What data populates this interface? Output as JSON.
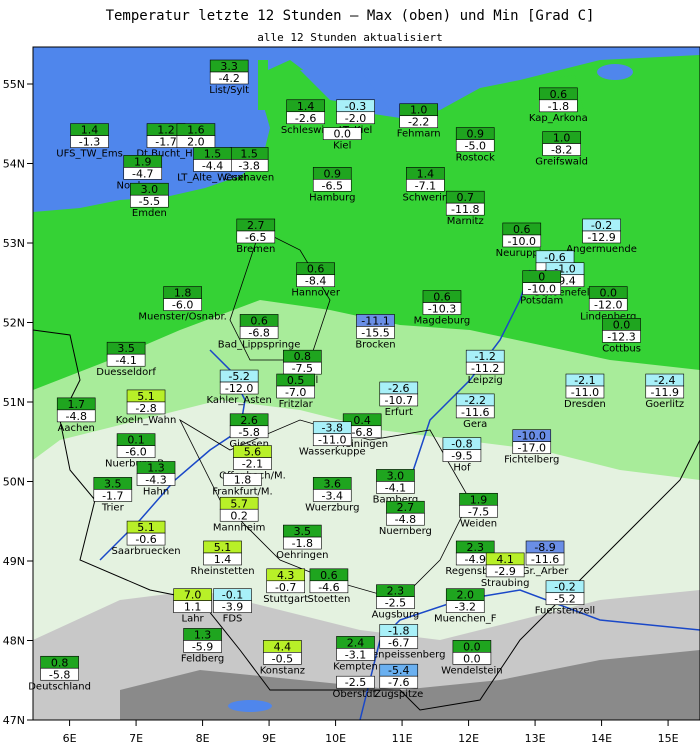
{
  "title": "Temperatur letzte 12 Stunden — Max (oben) und Min [Grad C]",
  "subtitle": "alle 12 Stunden aktualisiert",
  "lon_labels": [
    "6E",
    "7E",
    "8E",
    "9E",
    "10E",
    "11E",
    "12E",
    "13E",
    "14E",
    "15E"
  ],
  "lat_labels": [
    "55N",
    "54N",
    "53N",
    "52N",
    "51N",
    "50N",
    "49N",
    "48N",
    "47N"
  ],
  "stations": [
    {
      "name": "List/Sylt",
      "max": "3.3",
      "min": "-4.2",
      "lon": 8.4,
      "lat": 55.0,
      "c": "#1fa51f"
    },
    {
      "name": "UFS_TW_Ems",
      "max": "1.4",
      "min": "-1.3",
      "lon": 6.3,
      "lat": 54.2,
      "c": "#1fa51f"
    },
    {
      "name": "Dt.Bucht_H.",
      "max": "1.2",
      "min": "-1.7",
      "lon": 7.45,
      "lat": 54.2,
      "c": "#1fa51f"
    },
    {
      "name": "",
      "max": "1.6",
      "min": "2.0",
      "lon": 7.9,
      "lat": 54.2,
      "c": "#1fa51f"
    },
    {
      "name": "Cuxhaven",
      "max": "1.5",
      "min": "-3.8",
      "lon": 8.7,
      "lat": 53.9,
      "c": "#1fa51f"
    },
    {
      "name": "Norderney",
      "max": "1.9",
      "min": "-4.7",
      "lon": 7.1,
      "lat": 53.8,
      "c": "#1fa51f"
    },
    {
      "name": "LT_Alte_Weser",
      "max": "1.5",
      "min": "-4.4",
      "lon": 8.15,
      "lat": 53.9,
      "c": "#1fa51f"
    },
    {
      "name": "Emden",
      "max": "3.0",
      "min": "-5.5",
      "lon": 7.2,
      "lat": 53.45,
      "c": "#1fa51f"
    },
    {
      "name": "Schleswig",
      "max": "1.4",
      "min": "-2.6",
      "lon": 9.55,
      "lat": 54.5,
      "c": "#1fa51f"
    },
    {
      "name": "LT_Kiel",
      "max": "-0.3",
      "min": "-2.0",
      "lon": 10.3,
      "lat": 54.5,
      "c": "#a8f0f8"
    },
    {
      "name": "Kiel",
      "max": "",
      "min": "0.0",
      "lon": 10.1,
      "lat": 54.3,
      "c": "#1fa51f"
    },
    {
      "name": "Fehmarn",
      "max": "1.0",
      "min": "-2.2",
      "lon": 11.25,
      "lat": 54.45,
      "c": "#1fa51f"
    },
    {
      "name": "Rostock",
      "max": "0.9",
      "min": "-5.0",
      "lon": 12.1,
      "lat": 54.15,
      "c": "#1fa51f"
    },
    {
      "name": "Kap_Arkona",
      "max": "0.6",
      "min": "-1.8",
      "lon": 13.35,
      "lat": 54.65,
      "c": "#1fa51f"
    },
    {
      "name": "Greifswald",
      "max": "1.0",
      "min": "-8.2",
      "lon": 13.4,
      "lat": 54.1,
      "c": "#1fa51f"
    },
    {
      "name": "Hamburg",
      "max": "0.9",
      "min": "-6.5",
      "lon": 9.95,
      "lat": 53.65,
      "c": "#1fa51f"
    },
    {
      "name": "Schwerin",
      "max": "1.4",
      "min": "-7.1",
      "lon": 11.35,
      "lat": 53.65,
      "c": "#1fa51f"
    },
    {
      "name": "Marnitz",
      "max": "0.7",
      "min": "-11.8",
      "lon": 11.95,
      "lat": 53.35,
      "c": "#1fa51f"
    },
    {
      "name": "Bremen",
      "max": "2.7",
      "min": "-6.5",
      "lon": 8.8,
      "lat": 53.0,
      "c": "#1fa51f"
    },
    {
      "name": "Neuruppin",
      "max": "0.6",
      "min": "-10.0",
      "lon": 12.8,
      "lat": 52.95,
      "c": "#1fa51f"
    },
    {
      "name": "Angermuende",
      "max": "-0.2",
      "min": "-12.9",
      "lon": 14.0,
      "lat": 53.0,
      "c": "#a8f0f8"
    },
    {
      "name": "Tegel",
      "max": "-0.6",
      "min": "-9.4",
      "lon": 13.3,
      "lat": 52.6,
      "c": "#a8f0f8"
    },
    {
      "name": "Schoenefeld",
      "max": "-1.0",
      "min": "-9.4",
      "lon": 13.45,
      "lat": 52.45,
      "c": "#a8f0f8"
    },
    {
      "name": "Potsdam",
      "max": "0",
      "min": "-10.0",
      "lon": 13.1,
      "lat": 52.35,
      "c": "#1fa51f"
    },
    {
      "name": "Hannover",
      "max": "0.6",
      "min": "-8.4",
      "lon": 9.7,
      "lat": 52.45,
      "c": "#1fa51f"
    },
    {
      "name": "Muenster/Osnabr.",
      "max": "1.8",
      "min": "-6.0",
      "lon": 7.7,
      "lat": 52.15,
      "c": "#1fa51f"
    },
    {
      "name": "Lindenberg",
      "max": "0.0",
      "min": "-12.0",
      "lon": 14.1,
      "lat": 52.15,
      "c": "#1fa51f"
    },
    {
      "name": "Bad_Lippspringe",
      "max": "0.6",
      "min": "-6.8",
      "lon": 8.85,
      "lat": 51.8,
      "c": "#1fa51f"
    },
    {
      "name": "Magdeburg",
      "max": "0.6",
      "min": "-10.3",
      "lon": 11.6,
      "lat": 52.1,
      "c": "#1fa51f"
    },
    {
      "name": "Brocken",
      "max": "-11.1",
      "min": "-15.5",
      "lon": 10.6,
      "lat": 51.8,
      "c": "#6a8ee6"
    },
    {
      "name": "Cottbus",
      "max": "0.0",
      "min": "-12.3",
      "lon": 14.3,
      "lat": 51.75,
      "c": "#1fa51f"
    },
    {
      "name": "Duesseldorf",
      "max": "3.5",
      "min": "-4.1",
      "lon": 6.85,
      "lat": 51.45,
      "c": "#1fa51f"
    },
    {
      "name": "Kassel",
      "max": "0.8",
      "min": "-7.5",
      "lon": 9.5,
      "lat": 51.35,
      "c": "#1fa51f"
    },
    {
      "name": "Kahler_Asten",
      "max": "-5.2",
      "min": "-12.0",
      "lon": 8.55,
      "lat": 51.1,
      "c": "#a8f0f8"
    },
    {
      "name": "Fritzlar",
      "max": "0.5",
      "min": "-7.0",
      "lon": 9.4,
      "lat": 51.05,
      "c": "#1fa51f"
    },
    {
      "name": "Erfurt",
      "max": "-2.6",
      "min": "-10.7",
      "lon": 10.95,
      "lat": 50.95,
      "c": "#a8f0f8"
    },
    {
      "name": "Leipzig",
      "max": "-1.2",
      "min": "-11.2",
      "lon": 12.25,
      "lat": 51.35,
      "c": "#a8f0f8"
    },
    {
      "name": "Dresden",
      "max": "-2.1",
      "min": "-11.0",
      "lon": 13.75,
      "lat": 51.05,
      "c": "#a8f0f8"
    },
    {
      "name": "Goerlitz",
      "max": "-2.4",
      "min": "-11.9",
      "lon": 14.95,
      "lat": 51.05,
      "c": "#a8f0f8"
    },
    {
      "name": "Koeln_Wahn",
      "max": "5.1",
      "min": "-2.8",
      "lon": 7.15,
      "lat": 50.85,
      "c": "#b8f028"
    },
    {
      "name": "Aachen",
      "max": "1.7",
      "min": "-4.8",
      "lon": 6.1,
      "lat": 50.75,
      "c": "#1fa51f"
    },
    {
      "name": "Giessen",
      "max": "2.6",
      "min": "-5.8",
      "lon": 8.7,
      "lat": 50.55,
      "c": "#1fa51f"
    },
    {
      "name": "Meiningen",
      "max": "0.4",
      "min": "-6.8",
      "lon": 10.4,
      "lat": 50.55,
      "c": "#1fa51f"
    },
    {
      "name": "Wasserkuppe",
      "max": "-3.8",
      "min": "-11.0",
      "lon": 9.95,
      "lat": 50.45,
      "c": "#a8f0f8"
    },
    {
      "name": "Gera",
      "max": "-2.2",
      "min": "-11.6",
      "lon": 12.1,
      "lat": 50.8,
      "c": "#a8f0f8"
    },
    {
      "name": "Nuerburg_B.",
      "max": "0.1",
      "min": "-6.0",
      "lon": 7.0,
      "lat": 50.3,
      "c": "#1fa51f"
    },
    {
      "name": "Offenbach/M.",
      "max": "5.6",
      "min": "-2.1",
      "lon": 8.75,
      "lat": 50.15,
      "c": "#b8f028"
    },
    {
      "name": "Hof",
      "max": "-0.8",
      "min": "-9.5",
      "lon": 11.9,
      "lat": 50.25,
      "c": "#a8f0f8"
    },
    {
      "name": "Fichtelberg",
      "max": "-10.0",
      "min": "-17.0",
      "lon": 12.95,
      "lat": 50.35,
      "c": "#6a8ee6"
    },
    {
      "name": "Hahn",
      "max": "1.3",
      "min": "-4.3",
      "lon": 7.3,
      "lat": 49.95,
      "c": "#1fa51f"
    },
    {
      "name": "Frankfurt/M.",
      "max": "",
      "min": "1.8",
      "lon": 8.6,
      "lat": 49.95,
      "c": "#b8f028"
    },
    {
      "name": "Bamberg",
      "max": "3.0",
      "min": "-4.1",
      "lon": 10.9,
      "lat": 49.85,
      "c": "#1fa51f"
    },
    {
      "name": "Trier",
      "max": "3.5",
      "min": "-1.7",
      "lon": 6.65,
      "lat": 49.75,
      "c": "#1fa51f"
    },
    {
      "name": "Wuerzburg",
      "max": "3.6",
      "min": "-3.4",
      "lon": 9.95,
      "lat": 49.75,
      "c": "#1fa51f"
    },
    {
      "name": "Mannheim",
      "max": "5.7",
      "min": "0.2",
      "lon": 8.55,
      "lat": 49.5,
      "c": "#b8f028"
    },
    {
      "name": "Nuernberg",
      "max": "2.7",
      "min": "-4.8",
      "lon": 11.05,
      "lat": 49.45,
      "c": "#1fa51f"
    },
    {
      "name": "Weiden",
      "max": "1.9",
      "min": "-7.5",
      "lon": 12.15,
      "lat": 49.55,
      "c": "#1fa51f"
    },
    {
      "name": "Saarbruecken",
      "max": "5.1",
      "min": "-0.6",
      "lon": 7.15,
      "lat": 49.2,
      "c": "#b8f028"
    },
    {
      "name": "Oehringen",
      "max": "3.5",
      "min": "-1.8",
      "lon": 9.5,
      "lat": 49.15,
      "c": "#1fa51f"
    },
    {
      "name": "Regensburg",
      "max": "2.3",
      "min": "-4.9",
      "lon": 12.1,
      "lat": 48.95,
      "c": "#1fa51f"
    },
    {
      "name": "Gr._Arber",
      "max": "-8.9",
      "min": "-11.6",
      "lon": 13.15,
      "lat": 48.95,
      "c": "#6a8ee6"
    },
    {
      "name": "Rheinstetten",
      "max": "5.1",
      "min": "1.4",
      "lon": 8.3,
      "lat": 48.95,
      "c": "#b8f028"
    },
    {
      "name": "Straubing",
      "max": "4.1",
      "min": "-2.9",
      "lon": 12.55,
      "lat": 48.8,
      "c": "#b8f028"
    },
    {
      "name": "Stuttgart",
      "max": "4.3",
      "min": "-0.7",
      "lon": 9.25,
      "lat": 48.6,
      "c": "#b8f028"
    },
    {
      "name": "Stoetten",
      "max": "0.6",
      "min": "-4.6",
      "lon": 9.9,
      "lat": 48.6,
      "c": "#1fa51f"
    },
    {
      "name": "Fuerstenzell",
      "max": "-0.2",
      "min": "-5.2",
      "lon": 13.45,
      "lat": 48.45,
      "c": "#a8f0f8"
    },
    {
      "name": "Lahr",
      "max": "7.0",
      "min": "1.1",
      "lon": 7.85,
      "lat": 48.35,
      "c": "#b8f028"
    },
    {
      "name": "FDS",
      "max": "-0.1",
      "min": "-3.9",
      "lon": 8.45,
      "lat": 48.35,
      "c": "#a8f0f8"
    },
    {
      "name": "Augsburg",
      "max": "2.3",
      "min": "-2.5",
      "lon": 10.9,
      "lat": 48.4,
      "c": "#1fa51f"
    },
    {
      "name": "Muenchen_F",
      "max": "2.0",
      "min": "-3.2",
      "lon": 11.95,
      "lat": 48.35,
      "c": "#1fa51f"
    },
    {
      "name": "Hohenpeissenberg",
      "max": "-1.8",
      "min": "-6.7",
      "lon": 10.95,
      "lat": 47.9,
      "c": "#a8f0f8"
    },
    {
      "name": "Feldberg",
      "max": "1.3",
      "min": "-5.9",
      "lon": 8.0,
      "lat": 47.85,
      "c": "#1fa51f"
    },
    {
      "name": "Kempten",
      "max": "2.4",
      "min": "-3.1",
      "lon": 10.3,
      "lat": 47.75,
      "c": "#1fa51f"
    },
    {
      "name": "Konstanz",
      "max": "4.4",
      "min": "-0.5",
      "lon": 9.2,
      "lat": 47.7,
      "c": "#b8f028"
    },
    {
      "name": "Wendelstein",
      "max": "0.0",
      "min": "0.0",
      "lon": 12.05,
      "lat": 47.7,
      "c": "#1fa51f"
    },
    {
      "name": "Deutschland",
      "max": "0.8",
      "min": "-5.8",
      "lon": 5.85,
      "lat": 47.5,
      "c": "#1fa51f"
    },
    {
      "name": "Oberstdf.",
      "max": "",
      "min": "-2.5",
      "lon": 10.3,
      "lat": 47.4,
      "c": "#1fa51f"
    },
    {
      "name": "Zugspitze",
      "max": "-5.4",
      "min": "-7.6",
      "lon": 10.95,
      "lat": 47.4,
      "c": "#6ab0f0"
    }
  ]
}
